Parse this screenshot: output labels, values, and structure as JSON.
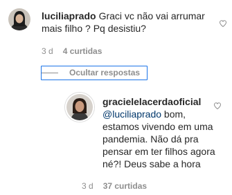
{
  "comment": {
    "username": "luciliaprado",
    "text": "Graci vc não vai arrumar mais filho ? Pq desistiu?",
    "time": "3 d",
    "likes": "4 curtidas"
  },
  "toggle_replies_label": "Ocultar respostas",
  "reply": {
    "username": "gracielelacerdaoficial",
    "mention": "@luciliaprado",
    "text_line1": " bom,",
    "text_line2": "estamos vivendo em uma",
    "text_line3": "pandemia. Não dá pra",
    "text_line4": "pensar em ter filhos agora",
    "text_line5": "né?! Deus sabe a hora",
    "time": "3 d",
    "likes": "37 curtidas"
  },
  "colors": {
    "text": "#262626",
    "secondary": "#8e8e8e",
    "mention": "#00376b",
    "focus": "#1a73e8"
  },
  "icons": {
    "like": "heart-outline-icon"
  }
}
